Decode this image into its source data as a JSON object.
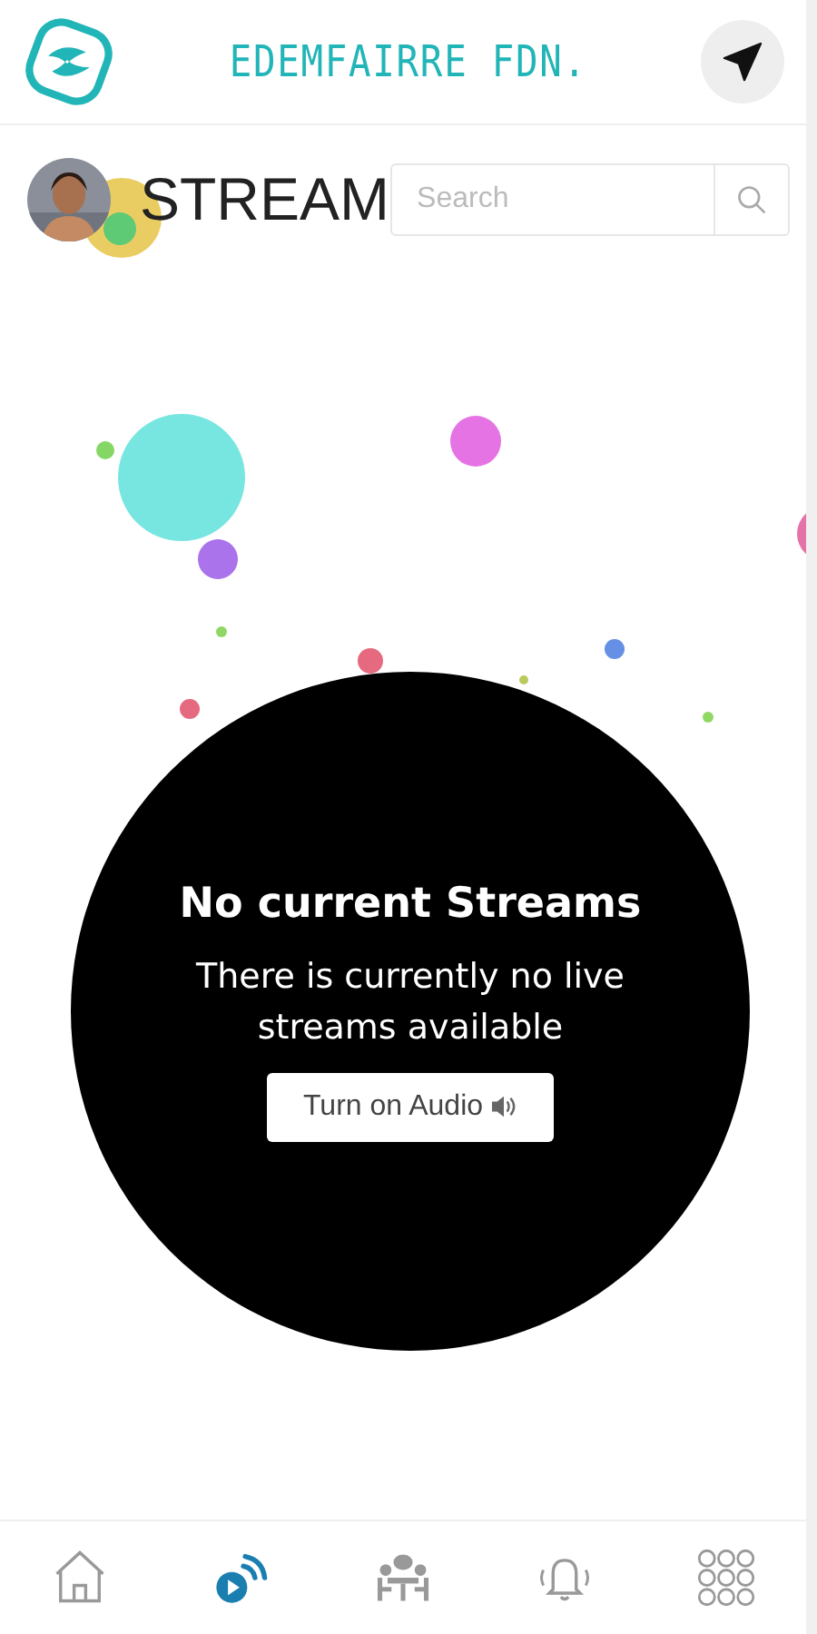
{
  "header": {
    "brand": "EDEMFAIRRE FDN."
  },
  "page": {
    "title": "STREAM",
    "search": {
      "placeholder": "Search"
    }
  },
  "notice": {
    "title": "No current Streams",
    "message": "There is currently no live streams available",
    "button": "Turn on Audio"
  },
  "nav": [
    {
      "kind": "home",
      "selected": false
    },
    {
      "kind": "stream",
      "selected": true
    },
    {
      "kind": "meeting",
      "selected": false
    },
    {
      "kind": "alerts",
      "selected": false
    },
    {
      "kind": "apps",
      "selected": false
    }
  ]
}
